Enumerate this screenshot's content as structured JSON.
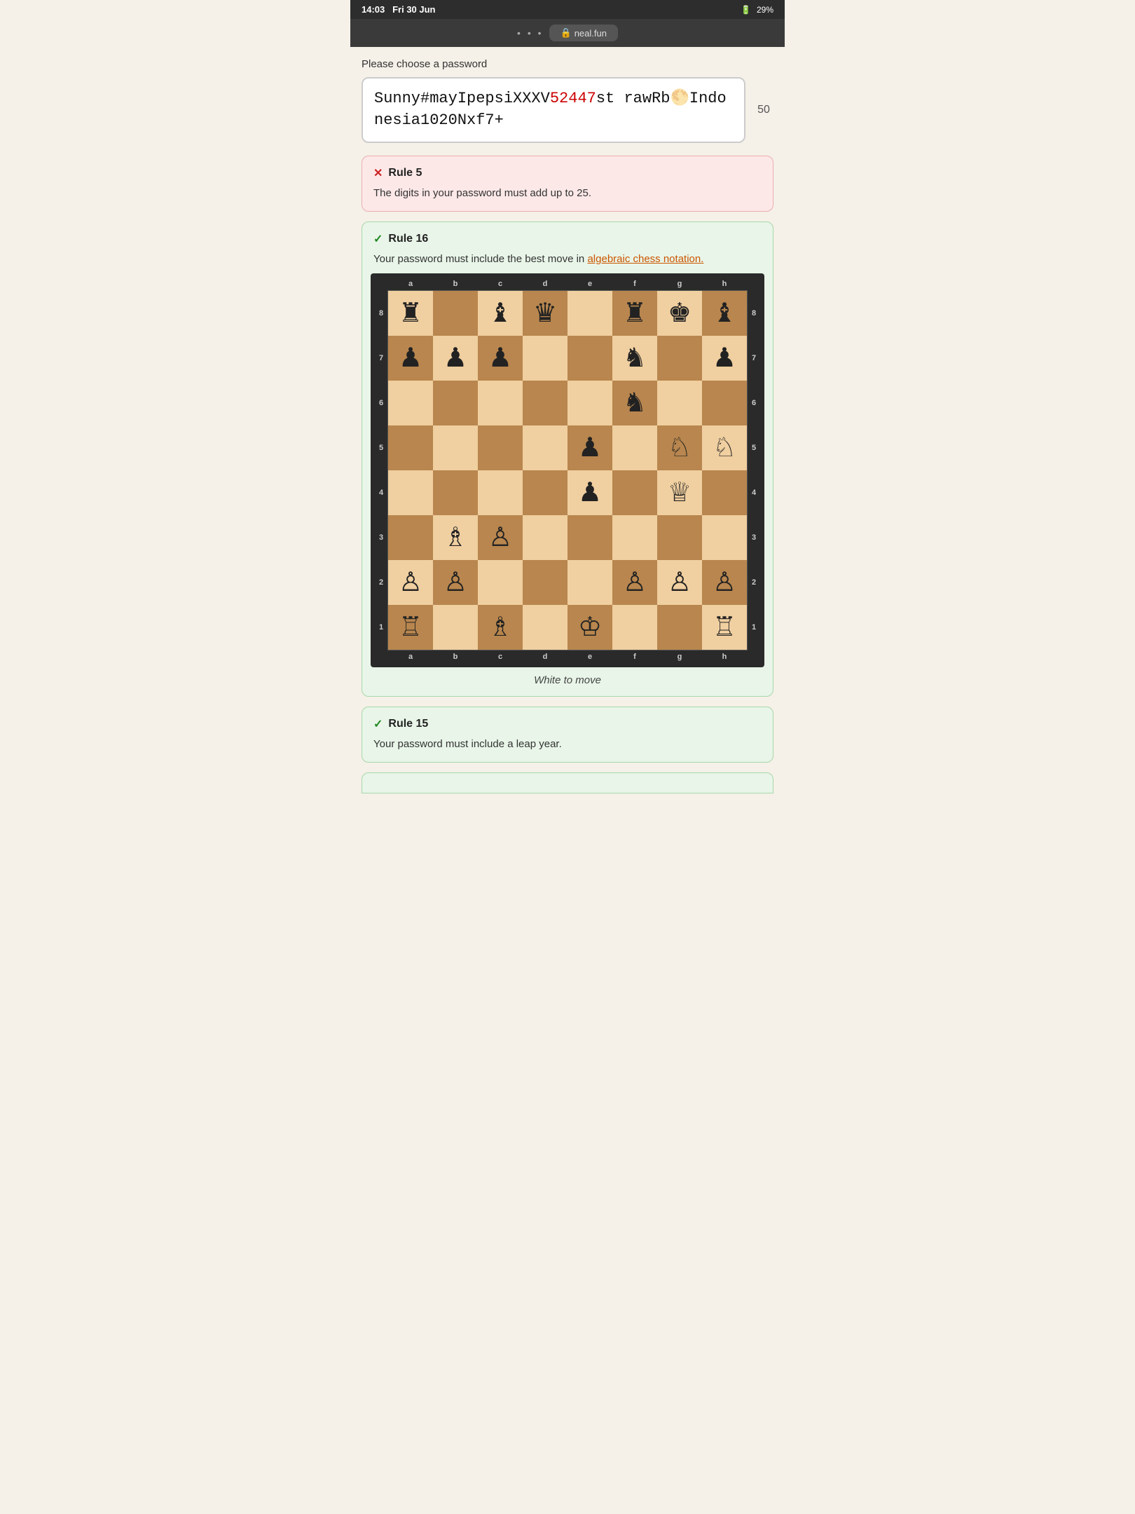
{
  "statusBar": {
    "time": "14:03",
    "date": "Fri 30 Jun",
    "battery": "29%",
    "batteryIcon": "🔋"
  },
  "browserBar": {
    "dots": "• • •",
    "lockIcon": "🔒",
    "url": "neal.fun"
  },
  "prompt": {
    "label": "Please choose a password"
  },
  "passwordBox": {
    "text": "Sunny#mayIpepsiXXXV52447strawRb🌕Indonesia1020Nxf7+",
    "charCount": "50"
  },
  "rules": {
    "rule5": {
      "number": "Rule 5",
      "status": "fail",
      "text": "The digits in your password must add up to 25."
    },
    "rule16": {
      "number": "Rule 16",
      "status": "pass",
      "linkText": "algebraic chess notation.",
      "textBefore": "Your password must include the best move in ",
      "caption": "White to move"
    },
    "rule15": {
      "number": "Rule 15",
      "status": "pass",
      "text": "Your password must include a leap year."
    }
  },
  "chess": {
    "files": [
      "a",
      "b",
      "c",
      "d",
      "e",
      "f",
      "g",
      "h"
    ],
    "ranks": [
      "8",
      "7",
      "6",
      "5",
      "4",
      "3",
      "2",
      "1"
    ],
    "board": [
      [
        "♜",
        "",
        "♝",
        "♛",
        "",
        "♜",
        "♚",
        "♝"
      ],
      [
        "♟",
        "♟",
        "♟",
        "",
        "",
        "♞",
        "",
        "♟"
      ],
      [
        "",
        "",
        "",
        "",
        "",
        "♞",
        "",
        ""
      ],
      [
        "",
        "",
        "",
        "",
        "♟",
        "",
        "♘",
        "♘"
      ],
      [
        "",
        "",
        "",
        "",
        "♟",
        "",
        "♕",
        ""
      ],
      [
        "",
        "♗",
        "♙",
        "",
        "",
        "",
        "",
        ""
      ],
      [
        "♙",
        "♙",
        "",
        "",
        "",
        "♙",
        "♙",
        "♙"
      ],
      [
        "♖",
        "",
        "♗",
        "",
        "♔",
        "",
        "",
        "♖"
      ]
    ]
  }
}
